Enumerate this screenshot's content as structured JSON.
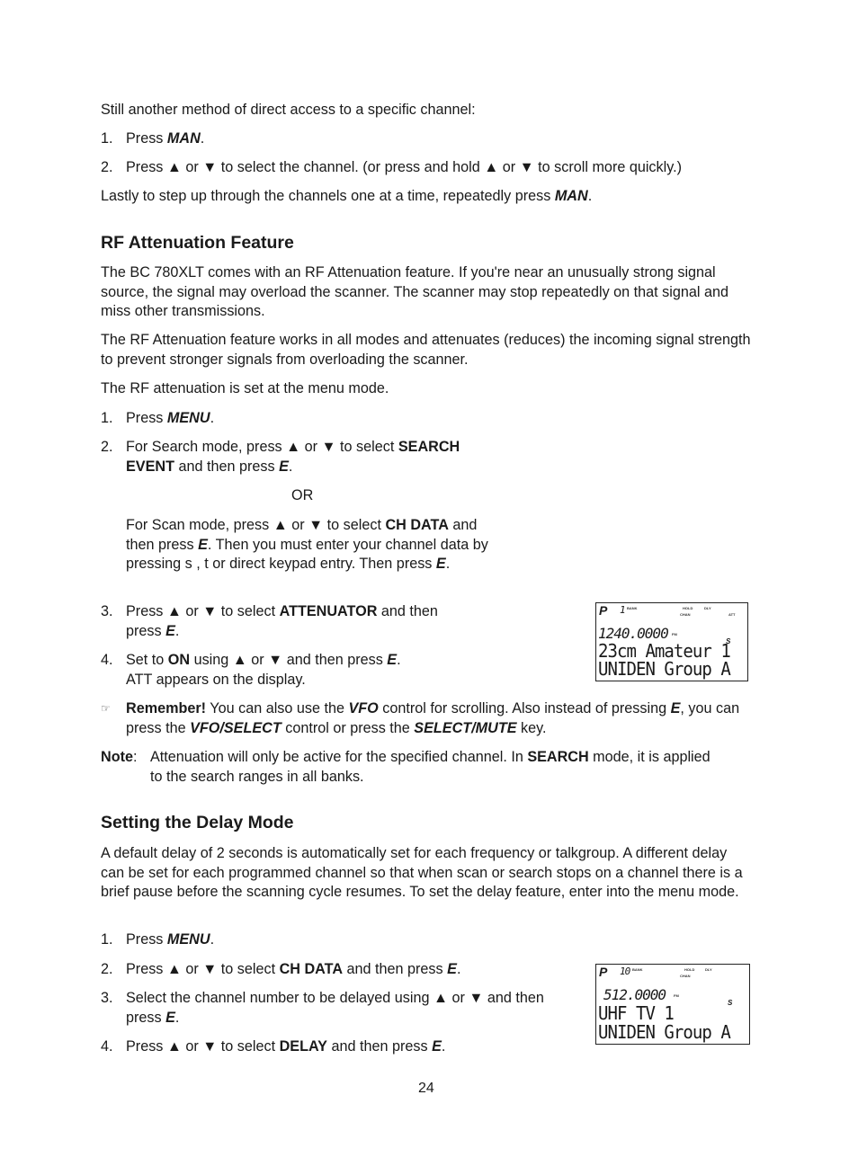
{
  "intro": {
    "lead": "Still another method of direct access to a specific channel:",
    "steps": [
      {
        "num": "1.",
        "pre": "Press ",
        "kw": "MAN",
        "post": "."
      },
      {
        "num": "2.",
        "text": "Press ▲ or ▼ to select the channel. (or press and hold ▲ or ▼ to scroll more quickly.)"
      }
    ],
    "lastly_pre": "Lastly to step up through the channels one at a time, repeatedly press ",
    "lastly_kw": "MAN",
    "lastly_post": "."
  },
  "rf_section": {
    "heading": "RF Attenuation Feature",
    "para1": "The BC 780XLT comes with an RF Attenuation feature. If you're near an unusually strong signal source, the signal may overload the scanner. The scanner may stop repeatedly on that signal and miss other transmissions.",
    "para2": "The RF Attenuation feature works in all modes and attenuates (reduces) the incoming signal strength to prevent stronger signals from overloading the scanner.",
    "para3": "The RF attenuation is set at the menu mode.",
    "step1": {
      "num": "1.",
      "pre": "Press ",
      "kw": "MENU",
      "post": "."
    },
    "step2": {
      "num": "2.",
      "pre": "For Search mode, press ▲ or ▼ to select ",
      "kw": "SEARCH EVENT",
      "mid": " and then press ",
      "kw2": "E",
      "post": "."
    },
    "or": "OR",
    "scan_alt": {
      "pre": "For Scan mode, press ▲ or ▼ to select ",
      "kw": "CH DATA",
      "mid": " and then press ",
      "kw2": "E",
      "mid2": ". Then you must enter your channel data by pressing s , t or direct keypad entry. Then press ",
      "kw3": "E",
      "post": "."
    },
    "step3": {
      "num": "3.",
      "pre": "Press ▲ or ▼ to select ",
      "kw": "ATTENUATOR",
      "mid": " and then press ",
      "kw2": "E",
      "post": "."
    },
    "step4": {
      "num": "4.",
      "pre": "Set to ",
      "kw": "ON",
      "mid": " using ▲ or ▼ and then press ",
      "kw2": "E",
      "post": ".",
      "line2": "ATT appears on the display."
    },
    "remember": {
      "icon": "☞",
      "kw": "Remember!",
      "t1": " You can also use the ",
      "k1": "VFO",
      "t2": " control for scrolling. Also instead of pressing ",
      "k2": "E",
      "t3": ", you can press the ",
      "k3": "VFO/SELECT",
      "t4": " control or press the ",
      "k4": "SELECT/MUTE",
      "t5": " key."
    },
    "note": {
      "label": "Note",
      "colon": ":",
      "t1": "Attenuation will only be active for the specified channel. In ",
      "kw": "SEARCH",
      "t2": " mode, it is applied to the search ranges in all banks."
    },
    "lcd": {
      "p": "P",
      "channel": "1",
      "bank_lbl": "BANK",
      "hold_lbl": "HOLD",
      "dly_lbl": "DLY",
      "chan_lbl": "CHAN",
      "att_lbl": "ATT",
      "freq": "1240.0000",
      "mode": "FM",
      "s": "S",
      "line1": "23cm Amateur 1",
      "line2": "UNIDEN Group A"
    }
  },
  "delay_section": {
    "heading": "Setting the Delay Mode",
    "para1": "A default delay of 2 seconds is automatically set for each frequency or talkgroup. A different delay can be set for each programmed channel so that when scan or search stops on a channel there is a brief pause before the scanning cycle resumes. To set the delay feature, enter into the menu mode.",
    "step1": {
      "num": "1.",
      "pre": "Press ",
      "kw": "MENU",
      "post": "."
    },
    "step2": {
      "num": "2.",
      "pre": "Press ▲ or ▼ to select ",
      "kw": "CH DATA",
      "mid": " and then press ",
      "kw2": "E",
      "post": "."
    },
    "step3": {
      "num": "3.",
      "pre": "Select the channel number to be delayed using ▲ or ▼ and then press ",
      "kw": "E",
      "post": "."
    },
    "step4": {
      "num": "4.",
      "pre": "Press ▲ or ▼ to select ",
      "kw": "DELAY",
      "mid": " and then press ",
      "kw2": "E",
      "post": "."
    },
    "lcd": {
      "p": "P",
      "channel": "10",
      "bank_lbl": "BANK",
      "hold_lbl": "HOLD",
      "dly_lbl": "DLY",
      "chan_lbl": "CHAN",
      "freq": "512.0000",
      "mode": "FM",
      "s": "S",
      "line1": "UHF TV 1",
      "line2": "UNIDEN Group A"
    }
  },
  "page_number": "24"
}
